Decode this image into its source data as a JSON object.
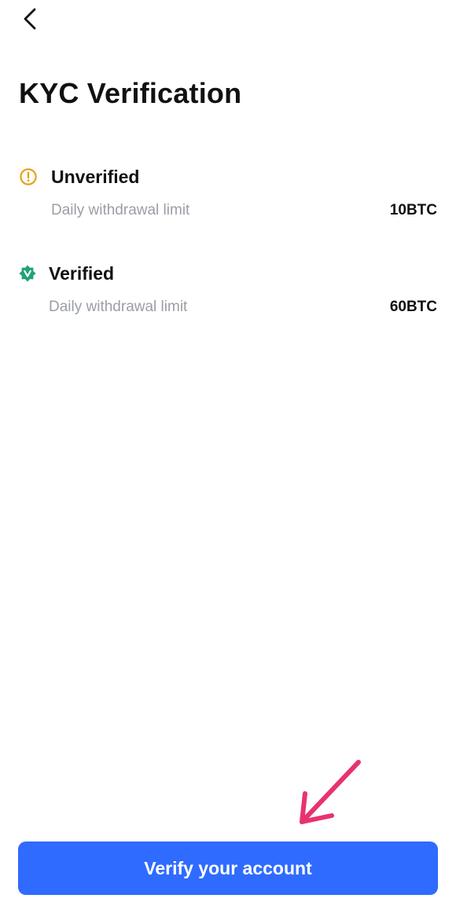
{
  "header": {
    "back_icon": "chevron-left-icon",
    "title": "KYC Verification"
  },
  "tiers": [
    {
      "status": "Unverified",
      "icon": "exclamation-circle-icon",
      "icon_color": "#E8A21A",
      "limit_label": "Daily withdrawal limit",
      "limit_value": "10BTC"
    },
    {
      "status": "Verified",
      "icon": "verified-badge-icon",
      "icon_color": "#1FA37A",
      "limit_label": "Daily withdrawal limit",
      "limit_value": "60BTC"
    }
  ],
  "footer": {
    "verify_button_label": "Verify your account",
    "button_color": "#2F6BFF",
    "arrow_color": "#E8336E"
  }
}
